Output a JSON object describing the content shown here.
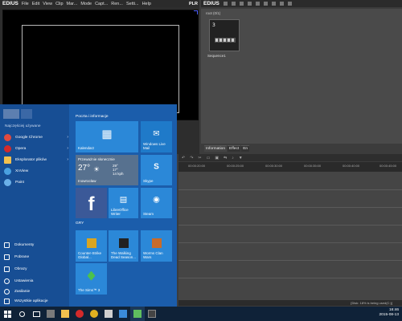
{
  "edius": {
    "logo": "EDIUS",
    "menu": [
      "File",
      "Edit",
      "View",
      "Clip",
      "Mar...",
      "Mode",
      "Capt...",
      "Ren...",
      "Setti...",
      "Help"
    ],
    "plr_label": "PLR"
  },
  "bin_window": {
    "logo": "EDIUS",
    "header": "root (0/1)",
    "clip_label": "Sequence1",
    "tabs": [
      "Information",
      "Effect",
      "En"
    ]
  },
  "timeline": {
    "ruler_ticks": [
      "00:00:20:00",
      "00:00:25:00",
      "00:00:30:00",
      "00:00:35:00",
      "00:00:40:00",
      "00:00:45:00"
    ],
    "status": "[Disk: 18% is being used(C:)]"
  },
  "start_menu": {
    "most_used_label": "Najczęściej używane",
    "apps": [
      {
        "label": "Google Chrome",
        "color": "#e04a3f",
        "arrow": "›"
      },
      {
        "label": "Opera",
        "color": "#d32a2a",
        "arrow": "›"
      },
      {
        "label": "Eksplorator plików",
        "color": "#f2c14e",
        "arrow": "›"
      },
      {
        "label": "XnView",
        "color": "#4aa1e0",
        "arrow": ""
      },
      {
        "label": "Paint",
        "color": "#6ab0e8",
        "arrow": ""
      }
    ],
    "system": [
      {
        "label": "Dokumenty",
        "icon": "document-icon"
      },
      {
        "label": "Pobrane",
        "icon": "download-icon"
      },
      {
        "label": "Obrazy",
        "icon": "picture-icon"
      },
      {
        "label": "Ustawienia",
        "icon": "gear-icon"
      },
      {
        "label": "Zasilanie",
        "icon": "power-icon"
      },
      {
        "label": "Wszystkie aplikacje",
        "icon": "apps-icon"
      }
    ],
    "group1_label": "Poczta i informacje",
    "group2_label": "GRY",
    "tiles": {
      "calendar": "Kalendarz",
      "mail": "Windows Live Mail",
      "weather_title": "Przeważnie słonecznie",
      "weather_temp": "27°",
      "weather_hi": "29°",
      "weather_lo": "17°",
      "weather_wind": "14 kph",
      "weather_city": "Inowrocław",
      "skype": "Skype",
      "facebook": "",
      "writer": "LibreOffice Writer",
      "steam": "Steam",
      "cs": "Counter-Strike Global...",
      "walkingdead": "The Walking Dead Season...",
      "worms": "Worms Clan Wars",
      "sims": "The Sims™ 3"
    }
  },
  "taskbar": {
    "time": "16:46",
    "date": "2015-08-13"
  }
}
